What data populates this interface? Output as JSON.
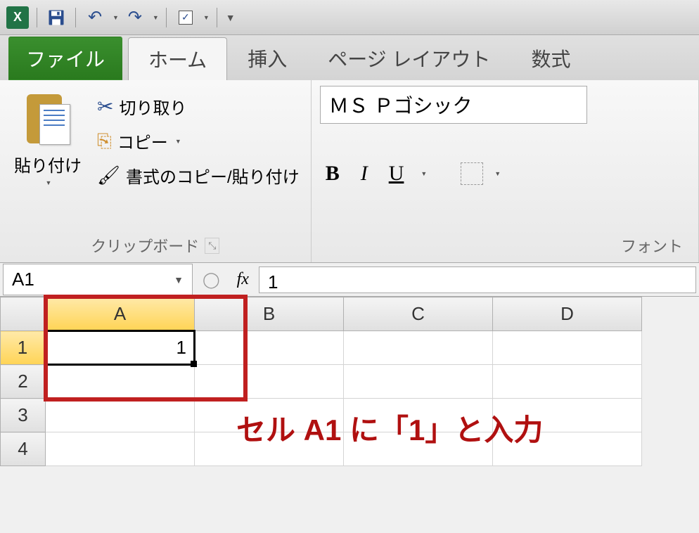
{
  "qat": {
    "undo": "↶",
    "redo": "↷",
    "check": "✓"
  },
  "tabs": {
    "file": "ファイル",
    "home": "ホーム",
    "insert": "挿入",
    "pagelayout": "ページ レイアウト",
    "formulas": "数式"
  },
  "clipboard": {
    "paste": "貼り付け",
    "cut": "切り取り",
    "copy": "コピー",
    "formatpainter": "書式のコピー/貼り付け",
    "label": "クリップボード"
  },
  "font": {
    "name": "ＭＳ Ｐゴシック",
    "bold": "B",
    "italic": "I",
    "underline": "U",
    "label": "フォント"
  },
  "namebox": "A1",
  "fx": "fx",
  "formula_value": "1",
  "columns": [
    "A",
    "B",
    "C",
    "D"
  ],
  "rows": [
    "1",
    "2",
    "3",
    "4"
  ],
  "cell_a1": "1",
  "annotation": "セル A1 に「1」と入力"
}
